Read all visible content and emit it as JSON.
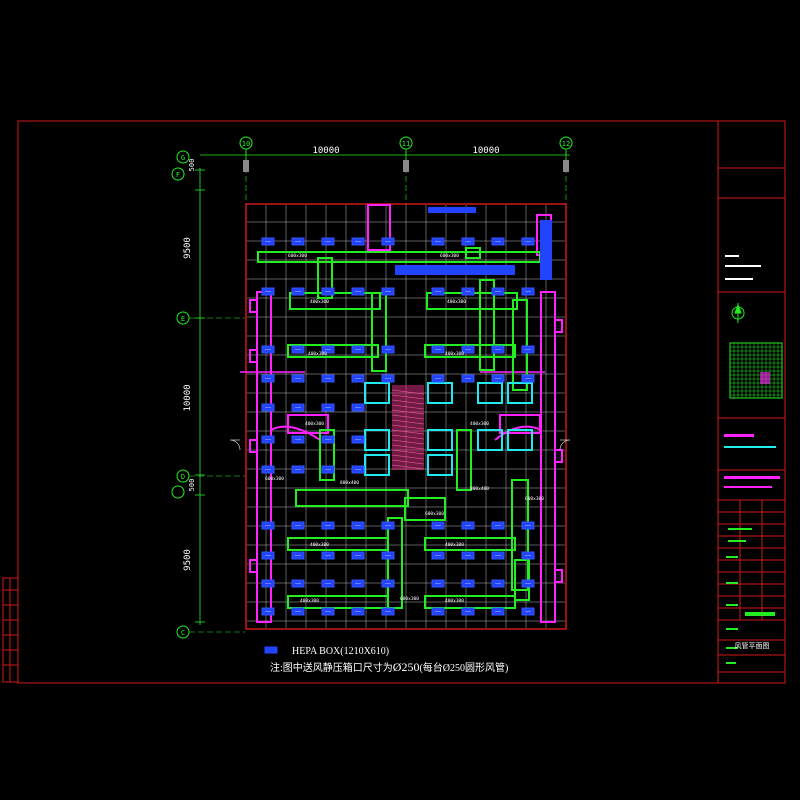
{
  "drawing": {
    "dimensions": {
      "top_left": "10000",
      "top_right": "10000",
      "left_top": "9500",
      "left_mid": "10000",
      "left_bottom": "9500",
      "small_top": "500",
      "small_mid": "500"
    },
    "column_tags": [
      "10",
      "11",
      "12"
    ],
    "row_tags": [
      "G",
      "F",
      "E",
      "D",
      "C"
    ],
    "duct_labels": [
      "400x300",
      "400x300",
      "400x300",
      "400x300",
      "400x300",
      "400x300",
      "400x300",
      "400x300",
      "600x300",
      "400x300",
      "400x300",
      "800x400",
      "800x400",
      "600x300",
      "600x300",
      "600x300",
      "600x300",
      "600x300"
    ],
    "legend": {
      "symbol_label": "HEPA BOX(1210X610)",
      "note_prefix": "注:图中送风静压箱口尺寸为",
      "note_value": "Ø250",
      "note_suffix": "(每台Ø250圆形风管)"
    },
    "title_block": {
      "drawing_title": "风管平面图"
    }
  },
  "colors": {
    "frame": "#d01818",
    "grid": "#b8b8b8",
    "magenta": "#ff22ff",
    "green": "#22ee22",
    "cyan": "#22e8f0",
    "blue": "#2244ff",
    "yellow": "#eeee22",
    "white": "#ffffff"
  }
}
